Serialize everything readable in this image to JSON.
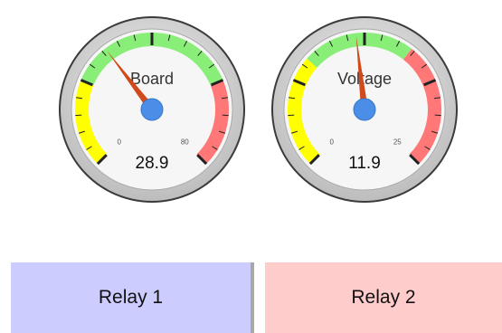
{
  "gauges": [
    {
      "id": "board",
      "label": "Board",
      "min": 0,
      "max": 80,
      "value": 28.9,
      "min_label": "0",
      "max_label": "80",
      "value_text": "28.9",
      "bands": [
        {
          "from": 0,
          "to": 20,
          "color": "#ffff00"
        },
        {
          "from": 20,
          "to": 60,
          "color": "#88ee77"
        },
        {
          "from": 60,
          "to": 80,
          "color": "#ff7777"
        }
      ],
      "needle_color": "#d14a1c",
      "hub_color": "#4a8ee8"
    },
    {
      "id": "voltage",
      "label": "Voltage",
      "min": 0,
      "max": 25,
      "value": 11.9,
      "min_label": "0",
      "max_label": "25",
      "value_text": "11.9",
      "bands": [
        {
          "from": 0,
          "to": 8,
          "color": "#ffff00"
        },
        {
          "from": 8,
          "to": 16,
          "color": "#88ee77"
        },
        {
          "from": 16,
          "to": 25,
          "color": "#ff7777"
        }
      ],
      "needle_color": "#d14a1c",
      "hub_color": "#4a8ee8"
    }
  ],
  "relays": [
    {
      "label": "Relay 1",
      "color": "#ccccff"
    },
    {
      "label": "Relay 2",
      "color": "#ffcccc"
    }
  ]
}
